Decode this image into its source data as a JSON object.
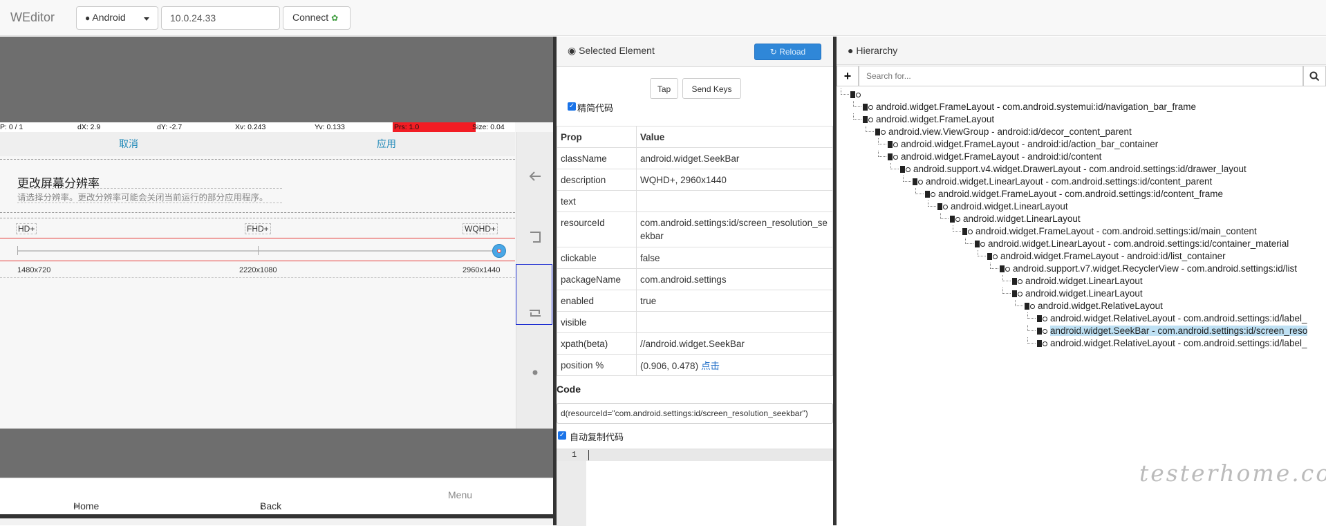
{
  "topbar": {
    "brand": "WEditor",
    "platform": "Android",
    "ip": "10.0.24.33",
    "connect_label": "Connect",
    "leaf_icon": "leaf-icon"
  },
  "screen": {
    "pointer": {
      "p": "P: 0 / 1",
      "dx": "dX: 2.9",
      "dy": "dY: -2.7",
      "xv": "Xv: 0.243",
      "yv": "Yv: 0.133",
      "prs": "Prs: 1.0",
      "size": "Size: 0.04"
    },
    "cancel": "取消",
    "apply": "应用",
    "title": "更改屏幕分辨率",
    "subtitle": "请选择分辨率。更改分辨率可能会关闭当前运行的部分应用程序。",
    "levels": [
      "HD+",
      "FHD+",
      "WQHD+"
    ],
    "resolutions": [
      "1480x720",
      "2220x1080",
      "2960x1440"
    ],
    "seek_value": 1.0,
    "bottom_nav": {
      "home": "Home",
      "back": "Back",
      "menu": "Menu"
    }
  },
  "element": {
    "title": "Selected Element",
    "reload": "Reload",
    "tap": "Tap",
    "send_keys": "Send Keys",
    "simplify": "精简代码",
    "headers": {
      "prop": "Prop",
      "value": "Value"
    },
    "props": [
      {
        "k": "className",
        "v": "android.widget.SeekBar"
      },
      {
        "k": "description",
        "v": "WQHD+, 2960x1440"
      },
      {
        "k": "text",
        "v": ""
      },
      {
        "k": "resourceId",
        "v": "com.android.settings:id/screen_resolution_seekbar"
      },
      {
        "k": "clickable",
        "v": "false"
      },
      {
        "k": "packageName",
        "v": "com.android.settings"
      },
      {
        "k": "enabled",
        "v": "true"
      },
      {
        "k": "visible",
        "v": ""
      },
      {
        "k": "xpath(beta)",
        "v": "//android.widget.SeekBar"
      },
      {
        "k": "position %",
        "v": "(0.906, 0.478)"
      }
    ],
    "position_link": "点击",
    "code_label": "Code",
    "code_value": "d(resourceId=\"com.android.settings:id/screen_resolution_seekbar\")",
    "auto_copy": "自动复制代码",
    "line_no": "1"
  },
  "hierarchy": {
    "title": "Hierarchy",
    "search_placeholder": "Search for...",
    "nodes": [
      {
        "label": "",
        "depth": 0
      },
      {
        "label": "android.widget.FrameLayout - com.android.systemui:id/navigation_bar_frame",
        "depth": 1
      },
      {
        "label": "android.widget.FrameLayout",
        "depth": 1
      },
      {
        "label": "android.view.ViewGroup - android:id/decor_content_parent",
        "depth": 2
      },
      {
        "label": "android.widget.FrameLayout - android:id/action_bar_container",
        "depth": 3
      },
      {
        "label": "android.widget.FrameLayout - android:id/content",
        "depth": 3
      },
      {
        "label": "android.support.v4.widget.DrawerLayout - com.android.settings:id/drawer_layout",
        "depth": 4
      },
      {
        "label": "android.widget.LinearLayout - com.android.settings:id/content_parent",
        "depth": 5
      },
      {
        "label": "android.widget.FrameLayout - com.android.settings:id/content_frame",
        "depth": 6
      },
      {
        "label": "android.widget.LinearLayout",
        "depth": 7
      },
      {
        "label": "android.widget.LinearLayout",
        "depth": 8
      },
      {
        "label": "android.widget.FrameLayout - com.android.settings:id/main_content",
        "depth": 9
      },
      {
        "label": "android.widget.LinearLayout - com.android.settings:id/container_material",
        "depth": 10
      },
      {
        "label": "android.widget.FrameLayout - android:id/list_container",
        "depth": 11
      },
      {
        "label": "android.support.v7.widget.RecyclerView - com.android.settings:id/list",
        "depth": 12
      },
      {
        "label": "android.widget.LinearLayout",
        "depth": 13
      },
      {
        "label": "android.widget.LinearLayout",
        "depth": 13
      },
      {
        "label": "android.widget.RelativeLayout",
        "depth": 14
      },
      {
        "label": "android.widget.RelativeLayout - com.android.settings:id/label_",
        "depth": 15
      },
      {
        "label": "android.widget.SeekBar - com.android.settings:id/screen_reso",
        "depth": 15,
        "selected": true
      },
      {
        "label": "android.widget.RelativeLayout - com.android.settings:id/label_",
        "depth": 15
      }
    ]
  },
  "watermark": "testerhome.com"
}
